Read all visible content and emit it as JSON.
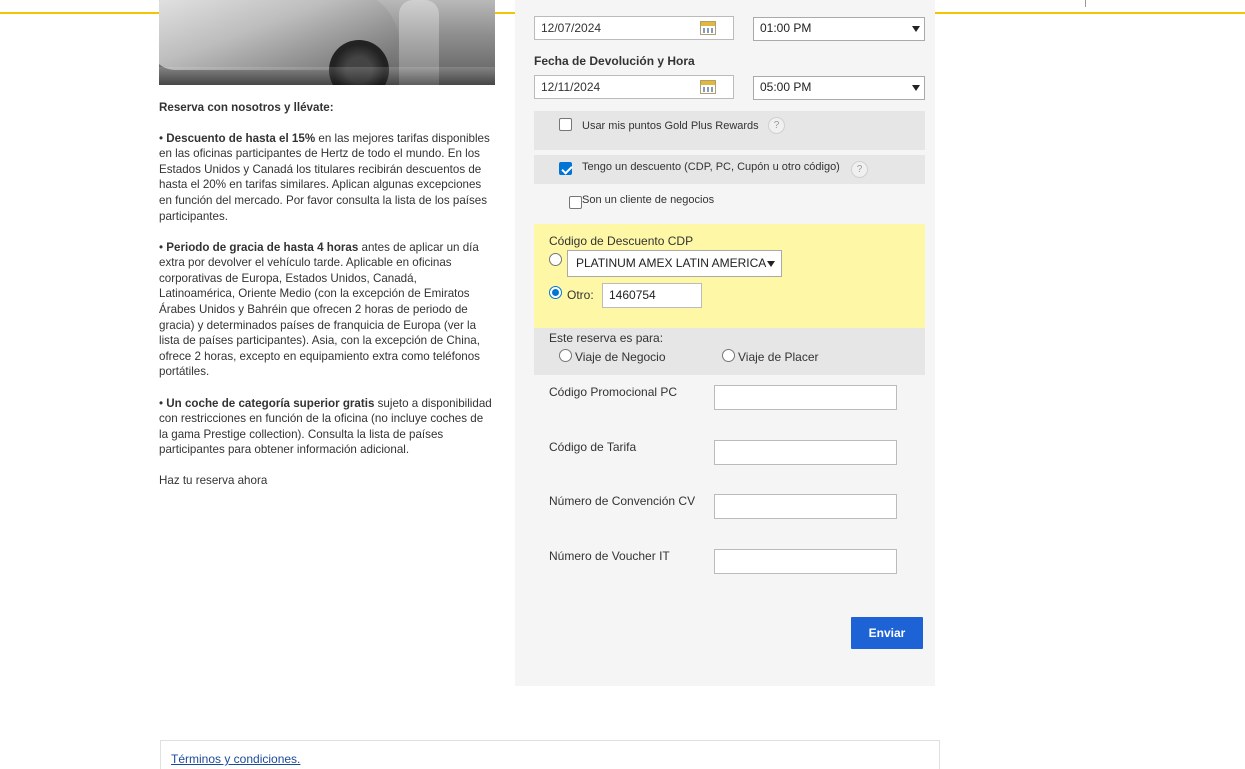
{
  "left": {
    "intro": "Reserva con nosotros y llévate:",
    "benefits": [
      {
        "bold": "Descuento de hasta el 15%",
        "text": " en las mejores tarifas disponibles en las oficinas participantes de Hertz de todo el mundo. En los Estados Unidos y Canadá los titulares recibirán descuentos de hasta el 20% en tarifas similares. Aplican algunas excepciones en función del mercado. Por favor consulta la lista de los países participantes."
      },
      {
        "bold": "Periodo de gracia de hasta 4 horas",
        "text": " antes de aplicar un día extra por devolver el vehículo tarde. Aplicable en oficinas corporativas de Europa, Estados Unidos, Canadá, Latinoamérica, Oriente Medio (con la excepción de Emiratos Árabes Unidos y Bahréin que ofrecen 2 horas de periodo de gracia) y determinados países de franquicia de Europa (ver la lista de países participantes). Asia, con la excepción de China, ofrece 2 horas, excepto en equipamiento extra como teléfonos portátiles."
      },
      {
        "bold": "Un coche de categoría superior gratis",
        "text": " sujeto a disponibilidad con restricciones en función de la oficina (no incluye coches de la gama Prestige collection). Consulta la lista de países participantes para obtener información adicional."
      }
    ],
    "bullet": "•",
    "cta": "Haz tu reserva ahora"
  },
  "form": {
    "pickup": {
      "date": "12/07/2024",
      "time": "01:00 PM"
    },
    "return": {
      "label": "Fecha de Devolución y Hora",
      "date": "12/11/2024",
      "time": "05:00 PM"
    },
    "gold_plus": {
      "label": "Usar mis puntos Gold Plus Rewards",
      "checked": false,
      "help": "?"
    },
    "discount": {
      "label": "Tengo un descuento (CDP, PC, Cupón u otro código)",
      "checked": true,
      "help": "?"
    },
    "business_client": {
      "label": "Son un cliente de negocios",
      "checked": false
    },
    "cdp": {
      "label": "Código de Descuento CDP",
      "selected_option": "PLATINUM AMEX LATIN AMERICA",
      "other_label": "Otro:",
      "other_value": "1460754"
    },
    "trip": {
      "label": "Este reserva es para:",
      "business": "Viaje de Negocio",
      "leisure": "Viaje de Placer"
    },
    "promo_code_label": "Código Promocional PC",
    "rate_code_label": "Código de Tarifa",
    "convention_label": "Número de Convención CV",
    "voucher_label": "Número de Voucher IT",
    "submit": "Enviar"
  },
  "footer": {
    "terms": "Términos y condiciones."
  },
  "colors": {
    "accent_yellow": "#f2c500",
    "cdp_box": "#fef7a6",
    "submit_blue": "#1e63d6",
    "link_blue": "#1a4a9a"
  }
}
